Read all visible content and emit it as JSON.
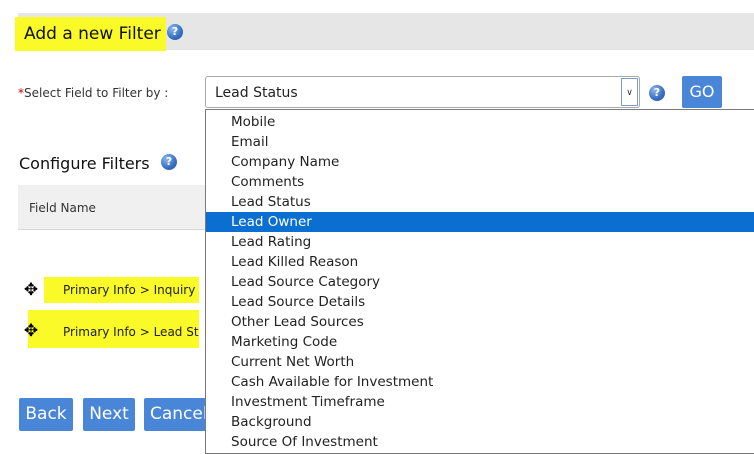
{
  "header": {
    "title": "Add a new Filter",
    "help_glyph": "?"
  },
  "field": {
    "required_mark": "*",
    "label": "Select Field to Filter by :",
    "selected_value": "Lead Status",
    "arrow_glyph": "∨",
    "help_glyph": "?",
    "go_label": "GO"
  },
  "configure": {
    "title": "Configure Filters",
    "help_glyph": "?",
    "column_header": "Field Name",
    "rows": [
      {
        "label": "Primary Info > Inquiry D",
        "move_glyph": "✥"
      },
      {
        "label": "Primary Info > Lead Stat",
        "move_glyph": "✥"
      }
    ]
  },
  "buttons": {
    "back": "Back",
    "next": "Next",
    "cancel": "Cancel"
  },
  "dropdown": {
    "highlighted": "Lead Owner",
    "options": [
      "Mobile",
      "Email",
      "Company Name",
      "Comments",
      "Lead Status",
      "Lead Owner",
      "Lead Rating",
      "Lead Killed Reason",
      "Lead Source Category",
      "Lead Source Details",
      "Other Lead Sources",
      "Marketing Code",
      "Current Net Worth",
      "Cash Available for Investment",
      "Investment Timeframe",
      "Background",
      "Source Of Investment"
    ]
  },
  "colors": {
    "accent": "#4a86d8",
    "highlight": "#fafa28",
    "selection": "#0a6fd0",
    "required": "#cc0000"
  }
}
